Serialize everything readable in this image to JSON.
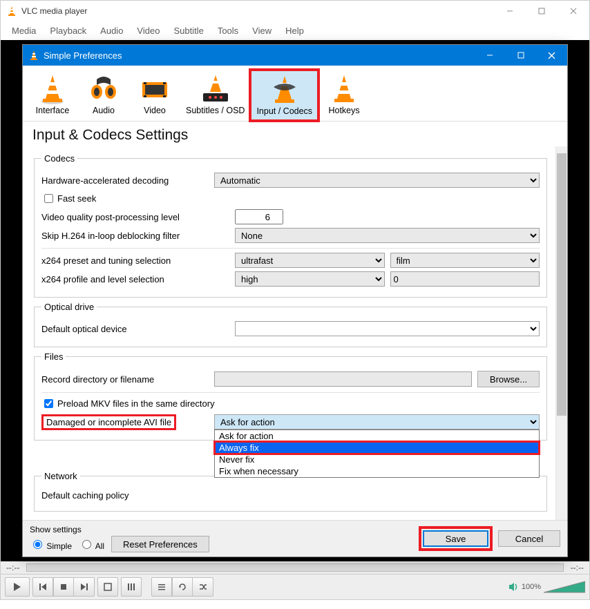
{
  "mainWindow": {
    "title": "VLC media player",
    "menus": [
      "Media",
      "Playback",
      "Audio",
      "Video",
      "Subtitle",
      "Tools",
      "View",
      "Help"
    ]
  },
  "dialog": {
    "title": "Simple Preferences",
    "categories": [
      {
        "label": "Interface"
      },
      {
        "label": "Audio"
      },
      {
        "label": "Video"
      },
      {
        "label": "Subtitles / OSD"
      },
      {
        "label": "Input / Codecs",
        "selected": true,
        "highlighted": true
      },
      {
        "label": "Hotkeys"
      }
    ],
    "heading": "Input & Codecs Settings",
    "codecs": {
      "legend": "Codecs",
      "hwDecodingLabel": "Hardware-accelerated decoding",
      "hwDecodingValue": "Automatic",
      "fastSeekLabel": "Fast seek",
      "fastSeekChecked": false,
      "vqLabel": "Video quality post-processing level",
      "vqValue": "6",
      "skipLabel": "Skip H.264 in-loop deblocking filter",
      "skipValue": "None",
      "x264PresetLabel": "x264 preset and tuning selection",
      "x264PresetValue": "ultrafast",
      "x264TuneValue": "film",
      "x264ProfileLabel": "x264 profile and level selection",
      "x264ProfileValue": "high",
      "x264LevelValue": "0"
    },
    "optical": {
      "legend": "Optical drive",
      "deviceLabel": "Default optical device",
      "deviceValue": ""
    },
    "files": {
      "legend": "Files",
      "recordLabel": "Record directory or filename",
      "recordValue": "",
      "browseLabel": "Browse...",
      "preloadLabel": "Preload MKV files in the same directory",
      "preloadChecked": true,
      "aviLabel": "Damaged or incomplete AVI file",
      "aviValue": "Ask for action",
      "aviOptions": [
        "Ask for action",
        "Always fix",
        "Never fix",
        "Fix when necessary"
      ],
      "aviSelectedOption": "Always fix"
    },
    "network": {
      "legend": "Network",
      "cachingLabel": "Default caching policy"
    },
    "footer": {
      "showSettingsLabel": "Show settings",
      "simpleLabel": "Simple",
      "allLabel": "All",
      "resetLabel": "Reset Preferences",
      "saveLabel": "Save",
      "cancelLabel": "Cancel"
    }
  },
  "status": {
    "leftTime": "--:--",
    "rightTime": "--:--",
    "volume": "100%"
  }
}
